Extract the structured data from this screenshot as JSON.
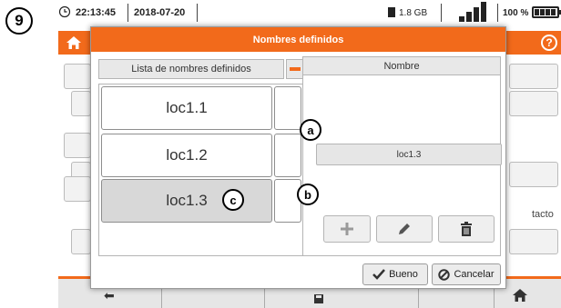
{
  "step_marker": "9",
  "status": {
    "time": "22:13:45",
    "date": "2018-07-20",
    "memory": "1.8 GB",
    "battery": "100 %"
  },
  "background": {
    "contact_label": "tacto"
  },
  "dialog": {
    "title": "Nombres definidos",
    "list_header": "Lista de nombres definidos",
    "items": [
      {
        "label": "loc1.1"
      },
      {
        "label": "loc1.2"
      },
      {
        "label": "loc1.3"
      }
    ],
    "selected_index": 2,
    "detail_header": "Nombre",
    "name_value": "loc1.3",
    "buttons": {
      "ok_label": "Bueno",
      "cancel_label": "Cancelar"
    }
  },
  "callouts": {
    "a": "a",
    "b": "b",
    "c": "c"
  },
  "icons": [
    "clock-icon",
    "sd-card-icon",
    "signal-icon",
    "battery-icon",
    "plug-icon",
    "home-icon",
    "help-icon",
    "plus-icon",
    "pencil-icon",
    "trash-icon",
    "check-icon",
    "cancel-icon",
    "floppy-icon",
    "back-icon"
  ],
  "colors": {
    "accent": "#f26a1b",
    "selected_item": "#d8d8d8",
    "button_bg": "#ececec"
  }
}
